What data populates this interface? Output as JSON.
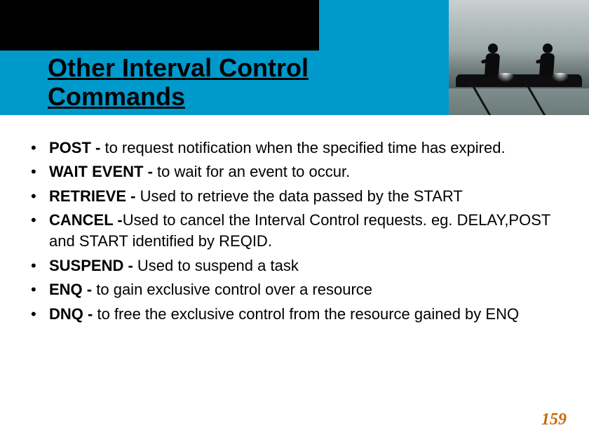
{
  "title": "Other Interval Control Commands",
  "items": [
    {
      "cmd": "POST",
      "sep": " - ",
      "desc": "to request notification when the specified time has expired."
    },
    {
      "cmd": "WAIT EVENT",
      "sep": " -  ",
      "desc": "to wait for an event to occur."
    },
    {
      "cmd": "RETRIEVE",
      "sep": " - ",
      "desc": "Used to retrieve the data passed by the START"
    },
    {
      "cmd": "CANCEL",
      "sep": " -",
      "desc": "Used to cancel the Interval Control requests. eg. DELAY,POST and START   identified by REQID."
    },
    {
      "cmd": "SUSPEND",
      "sep": " - ",
      "desc": "Used to suspend a task"
    },
    {
      "cmd": "ENQ",
      "sep": " - ",
      "desc": "to gain exclusive control over a resource"
    },
    {
      "cmd": "DNQ",
      "sep": " - ",
      "desc": "to free  the exclusive control from the resource gained by ENQ"
    }
  ],
  "page_number": "159"
}
